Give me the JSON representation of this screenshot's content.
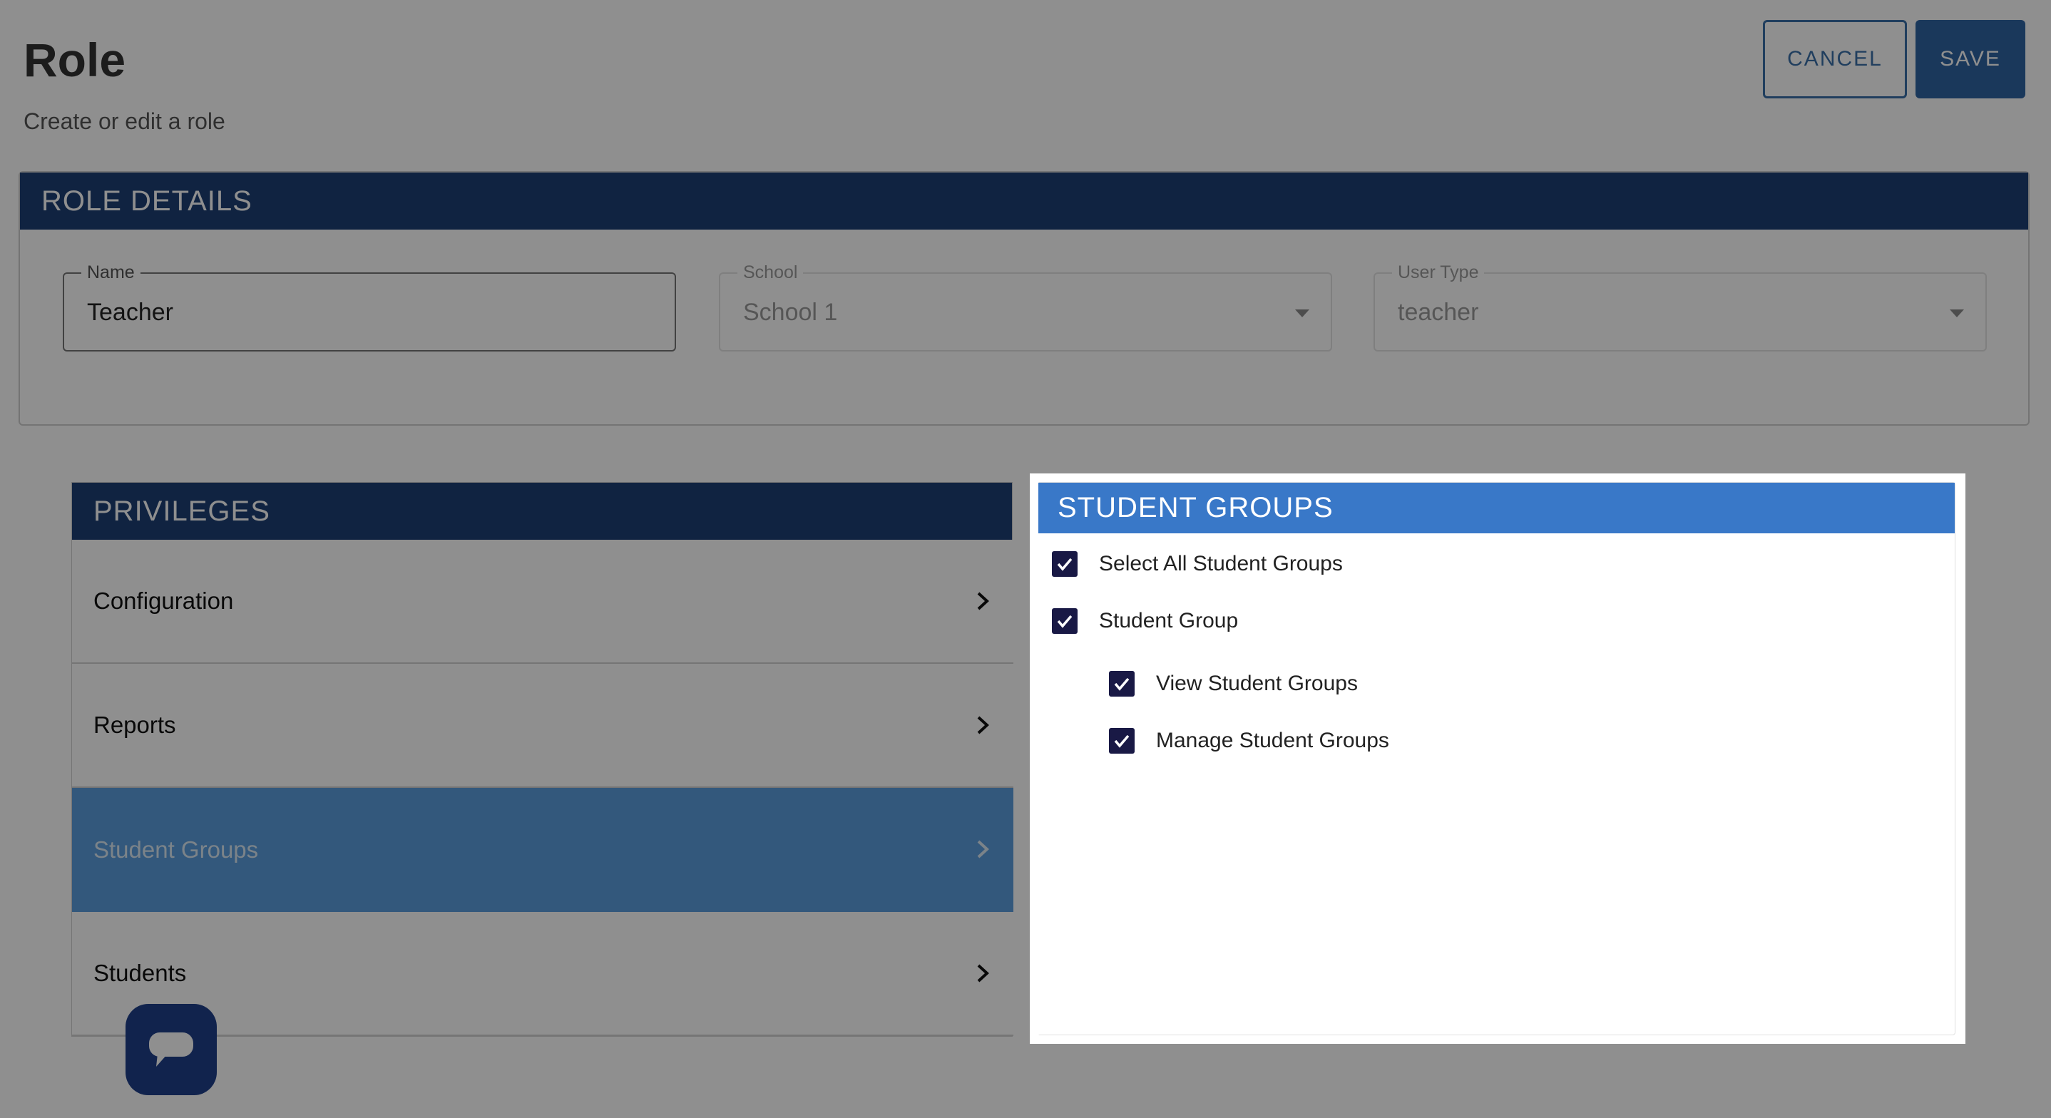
{
  "header": {
    "title": "Role",
    "subtitle": "Create or edit a role",
    "cancel_label": "CANCEL",
    "save_label": "SAVE"
  },
  "role_details": {
    "heading": "ROLE DETAILS",
    "name": {
      "label": "Name",
      "value": "Teacher"
    },
    "school": {
      "label": "School",
      "value": "School 1"
    },
    "user_type": {
      "label": "User Type",
      "value": "teacher"
    }
  },
  "privileges": {
    "heading": "PRIVILEGES",
    "items": [
      {
        "label": "Configuration",
        "active": false
      },
      {
        "label": "Reports",
        "active": false
      },
      {
        "label": "Student Groups",
        "active": true
      },
      {
        "label": "Students",
        "active": false
      }
    ]
  },
  "student_groups": {
    "heading": "STUDENT GROUPS",
    "checks": [
      {
        "label": "Select All Student Groups",
        "checked": true
      },
      {
        "label": "Student Group",
        "checked": true
      },
      {
        "label": "View Student Groups",
        "checked": true
      },
      {
        "label": "Manage Student Groups",
        "checked": true
      }
    ]
  },
  "colors": {
    "header_navy": "#1d3f74",
    "panel_blue": "#3978c8",
    "active_item": "#5b9ddd",
    "checkbox": "#191945",
    "chat_button": "#1f3f8a"
  },
  "icons": {
    "chevron": "chevron-right-icon",
    "caret": "caret-down-icon",
    "check": "check-icon",
    "chat": "chat-bubble-icon"
  }
}
